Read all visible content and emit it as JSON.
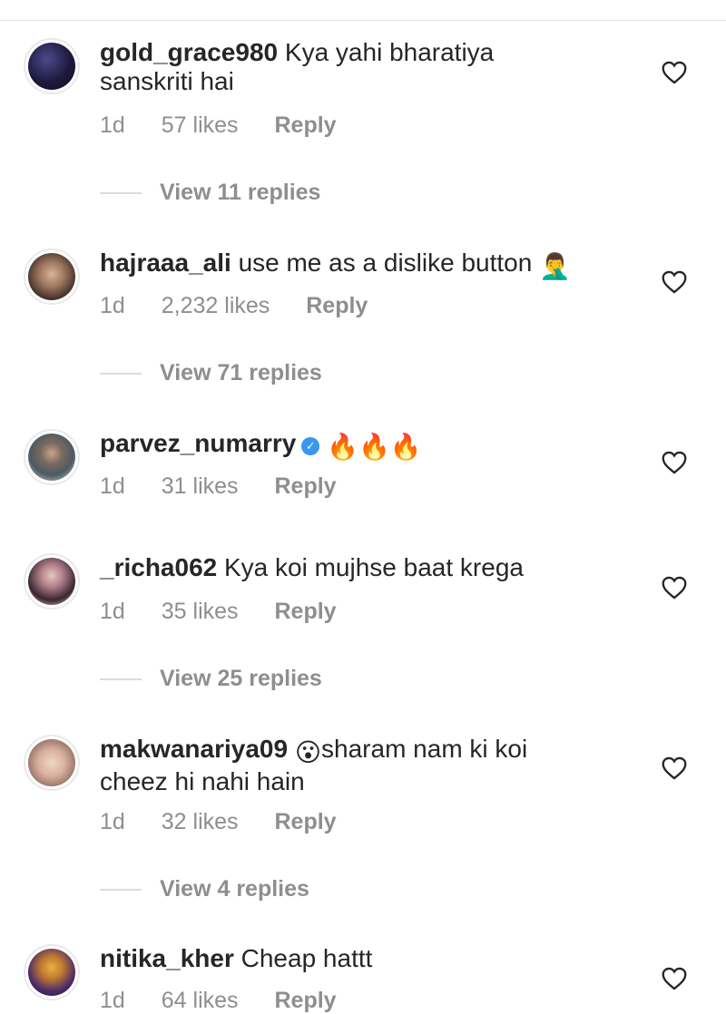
{
  "comments": [
    {
      "username": "gold_grace980",
      "text_lines": [
        "Kya yahi bharatiya",
        "sanskriti hai"
      ],
      "time": "1d",
      "likes": "57 likes",
      "reply_label": "Reply",
      "view_replies": "View 11 replies"
    },
    {
      "username": "hajraaa_ali",
      "text_lines": [
        "use me as a dislike button"
      ],
      "emoji": "🤦‍♂️",
      "time": "1d",
      "likes": "2,232 likes",
      "reply_label": "Reply",
      "view_replies": "View 71 replies"
    },
    {
      "username": "parvez_numarry",
      "verified": true,
      "text_lines": [
        ""
      ],
      "emoji": "🔥🔥🔥",
      "time": "1d",
      "likes": "31 likes",
      "reply_label": "Reply"
    },
    {
      "username": "_richa062",
      "text_lines": [
        "Kya koi mujhse baat krega"
      ],
      "time": "1d",
      "likes": "35 likes",
      "reply_label": "Reply",
      "view_replies": "View 25 replies"
    },
    {
      "username": "makwanariya09",
      "emoji": "😮",
      "text_lines": [
        "sharam nam ki koi",
        "cheez hi nahi hain"
      ],
      "time": "1d",
      "likes": "32 likes",
      "reply_label": "Reply",
      "view_replies": "View 4 replies"
    },
    {
      "username": "nitika_kher",
      "text_lines": [
        "Cheap hattt"
      ],
      "time": "1d",
      "likes": "64 likes",
      "reply_label": "Reply"
    }
  ],
  "icons": {
    "like": "heart-outline-icon",
    "verified": "verified-badge-icon"
  },
  "colors": {
    "text": "#262626",
    "secondary": "#8e8e8e",
    "verified": "#3897f0",
    "divider": "#dbdbdb"
  }
}
